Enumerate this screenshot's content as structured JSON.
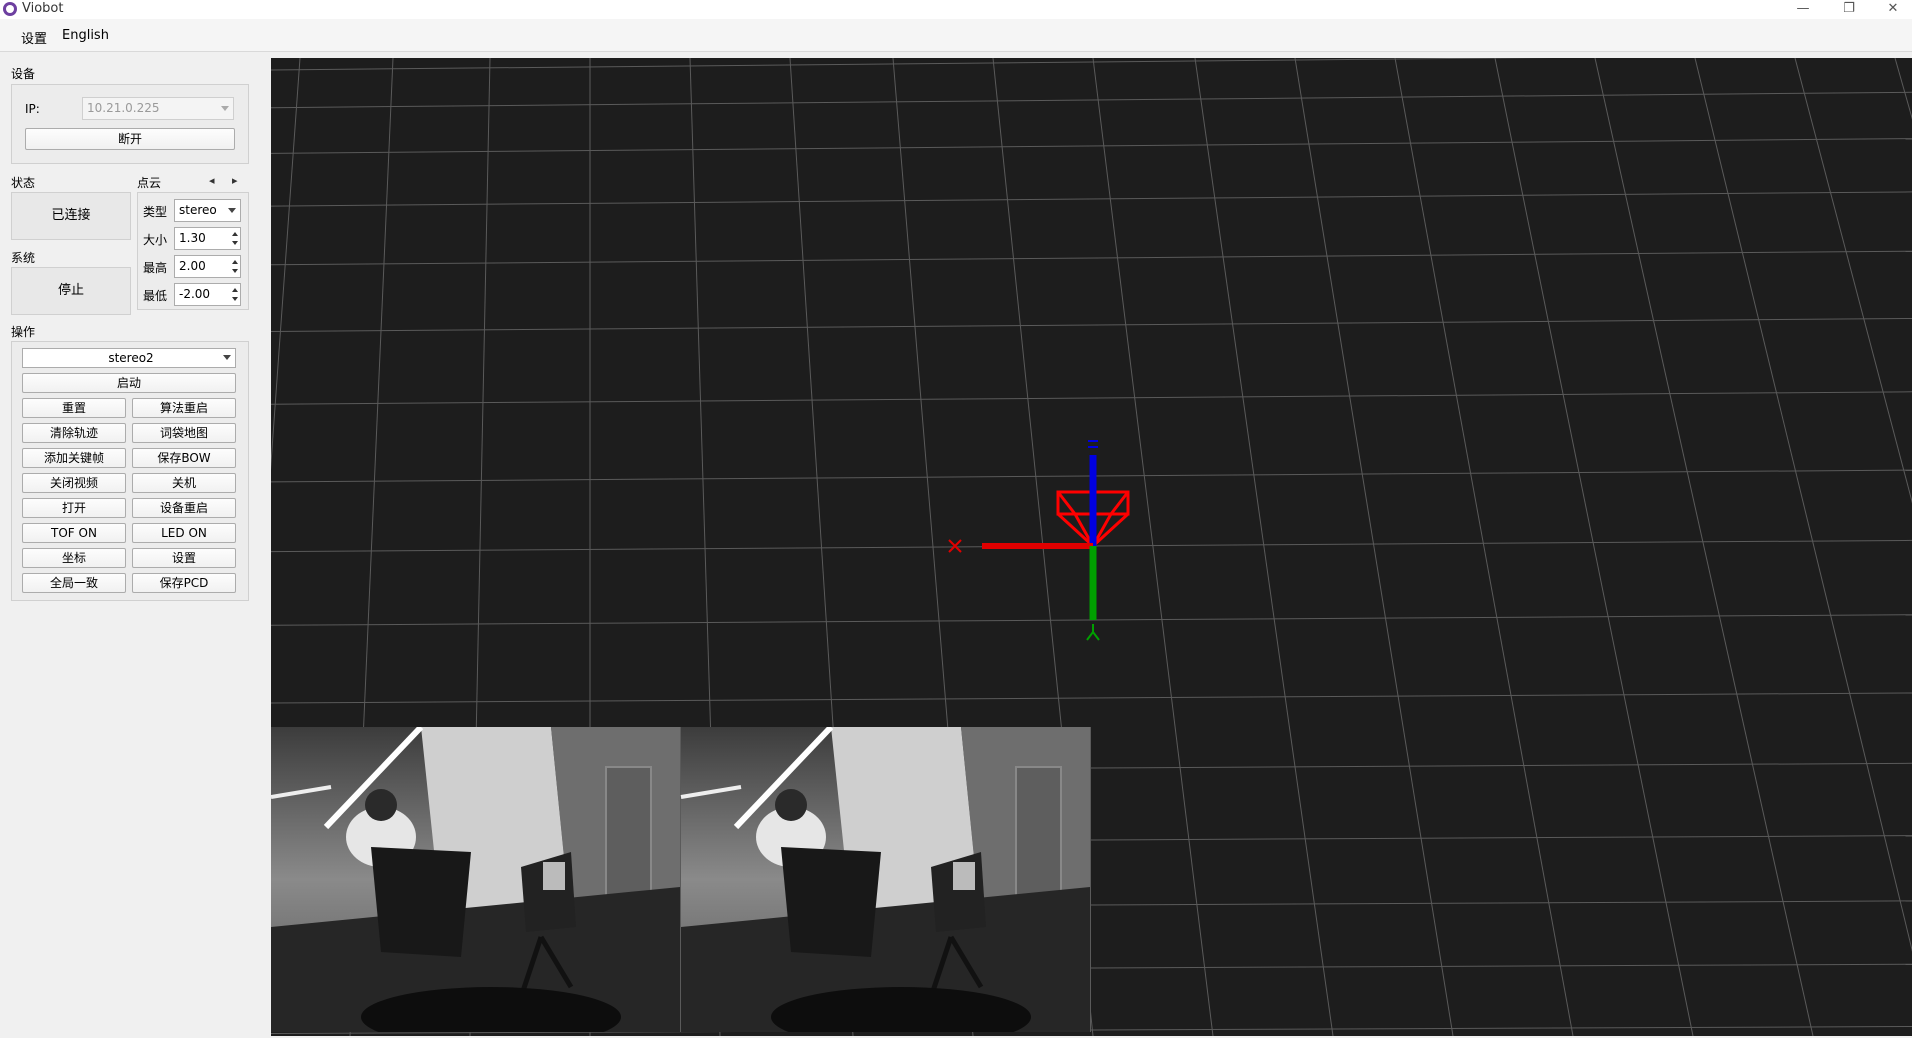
{
  "window": {
    "title": "Viobot",
    "minimize": "—",
    "restore": "❐",
    "close": "✕"
  },
  "menu": {
    "settings": "设置",
    "language": "English"
  },
  "device": {
    "section": "设备",
    "ip_label": "IP:",
    "ip_value": "10.21.0.225",
    "disconnect": "断开"
  },
  "status": {
    "section": "状态",
    "value": "已连接"
  },
  "system": {
    "section": "系统",
    "value": "停止"
  },
  "pointcloud": {
    "section": "点云",
    "prev": "◂",
    "next": "▸",
    "type_label": "类型",
    "type_value": "stereo",
    "size_label": "大小",
    "size_value": "1.30",
    "max_label": "最高",
    "max_value": "2.00",
    "min_label": "最低",
    "min_value": "-2.00"
  },
  "operations": {
    "section": "操作",
    "mode": "stereo2",
    "start": "启动",
    "buttons": [
      [
        "重置",
        "算法重启"
      ],
      [
        "清除轨迹",
        "词袋地图"
      ],
      [
        "添加关键帧",
        "保存BOW"
      ],
      [
        "关闭视频",
        "关机"
      ],
      [
        "打开",
        "设备重启"
      ],
      [
        "TOF ON",
        "LED ON"
      ],
      [
        "坐标",
        "设置"
      ],
      [
        "全局一致",
        "保存PCD"
      ]
    ]
  },
  "viewer": {
    "background": "#1d1d1d",
    "grid_color": "#5a5a5a",
    "x_axis_color": "#e00000",
    "y_axis_color": "#00a000",
    "z_axis_color": "#0000e0",
    "camera_frustum_color": "#ff0000"
  }
}
